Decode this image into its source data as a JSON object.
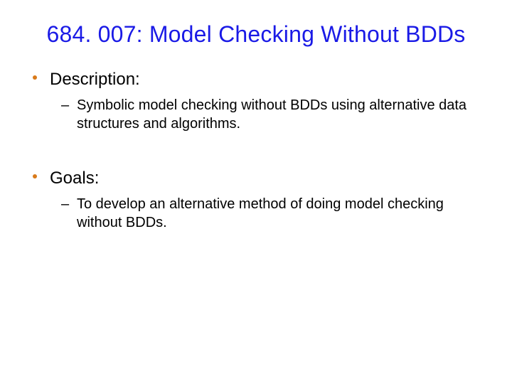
{
  "title": "684. 007: Model Checking Without BDDs",
  "sections": [
    {
      "heading": "Description:",
      "items": [
        "Symbolic model checking without BDDs using alternative data structures and algorithms."
      ]
    },
    {
      "heading": "Goals:",
      "items": [
        "To develop an alternative method of doing model checking without BDDs."
      ]
    }
  ],
  "dash": "–"
}
